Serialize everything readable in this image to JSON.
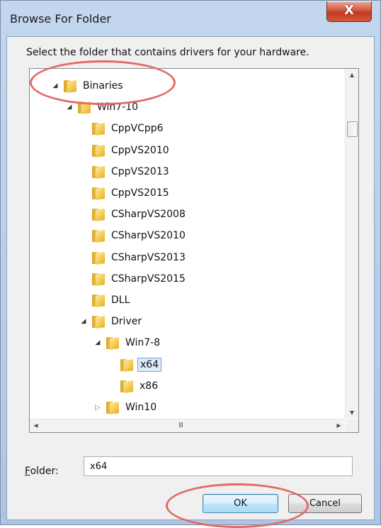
{
  "window": {
    "title": "Browse For Folder",
    "close_label": "X"
  },
  "instruction": "Select the folder that contains drivers for your hardware.",
  "tree": {
    "nodes": [
      {
        "label": "Binaries",
        "level": 0,
        "state": "expanded"
      },
      {
        "label": "Win7-10",
        "level": 1,
        "state": "expanded"
      },
      {
        "label": "CppVCpp6",
        "level": 2,
        "state": "leaf"
      },
      {
        "label": "CppVS2010",
        "level": 2,
        "state": "leaf"
      },
      {
        "label": "CppVS2013",
        "level": 2,
        "state": "leaf"
      },
      {
        "label": "CppVS2015",
        "level": 2,
        "state": "leaf"
      },
      {
        "label": "CSharpVS2008",
        "level": 2,
        "state": "leaf"
      },
      {
        "label": "CSharpVS2010",
        "level": 2,
        "state": "leaf"
      },
      {
        "label": "CSharpVS2013",
        "level": 2,
        "state": "leaf"
      },
      {
        "label": "CSharpVS2015",
        "level": 2,
        "state": "leaf"
      },
      {
        "label": "DLL",
        "level": 2,
        "state": "leaf"
      },
      {
        "label": "Driver",
        "level": 2,
        "state": "expanded"
      },
      {
        "label": "Win7-8",
        "level": 3,
        "state": "expanded"
      },
      {
        "label": "x64",
        "level": 4,
        "state": "leaf",
        "selected": true
      },
      {
        "label": "x86",
        "level": 4,
        "state": "leaf"
      },
      {
        "label": "Win10",
        "level": 3,
        "state": "collapsed"
      }
    ],
    "hscroll_grip": "III"
  },
  "folder": {
    "label_accel": "F",
    "label_rest": "older:",
    "value": "x64"
  },
  "buttons": {
    "ok": "OK",
    "cancel": "Cancel"
  },
  "colors": {
    "highlight": "#e26a67",
    "selection_bg": "#dceafc",
    "window_frame": "#b8cde9"
  }
}
